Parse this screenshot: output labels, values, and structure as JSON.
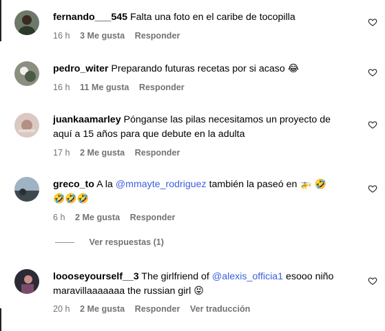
{
  "comments": [
    {
      "username": "fernando___545",
      "text": "Falta una foto en el caribe de tocopilla",
      "time": "16 h",
      "likes": "3 Me gusta",
      "reply": "Responder"
    },
    {
      "username": "pedro_witer",
      "text": "Preparando futuras recetas por si acaso",
      "emoji": "😂",
      "time": "16 h",
      "likes": "11 Me gusta",
      "reply": "Responder"
    },
    {
      "username": "juankaamarley",
      "text_line1": "Pónganse las pilas necesitamos un proyecto de",
      "text_line2": "aquí a 15 años para que debute en la adulta",
      "time": "17 h",
      "likes": "2 Me gusta",
      "reply": "Responder"
    },
    {
      "username": "greco_to",
      "text_pre": "A la",
      "mention": "@mmayte_rodriguez",
      "text_post": "también la paseó en",
      "emoji_helicopter": "🚁",
      "emoji_laugh": "🤣",
      "emoji_line2": "🤣🤣🤣",
      "time": "6 h",
      "likes": "2 Me gusta",
      "reply": "Responder"
    },
    {
      "username": "loooseyourself__3",
      "text_pre": "The girlfriend of",
      "mention": "@alexis_officia1",
      "text_post": "esooo niño",
      "text_line2": "maravillaaaaaaa the russian girl",
      "emoji": "😝",
      "time": "20 h",
      "likes": "2 Me gusta",
      "reply": "Responder",
      "translate": "Ver traducción"
    }
  ],
  "view_replies": "Ver respuestas (1)",
  "colors": {
    "meta": "#737373",
    "mention": "#3b5fdd"
  },
  "icons": [
    "heart-icon"
  ]
}
